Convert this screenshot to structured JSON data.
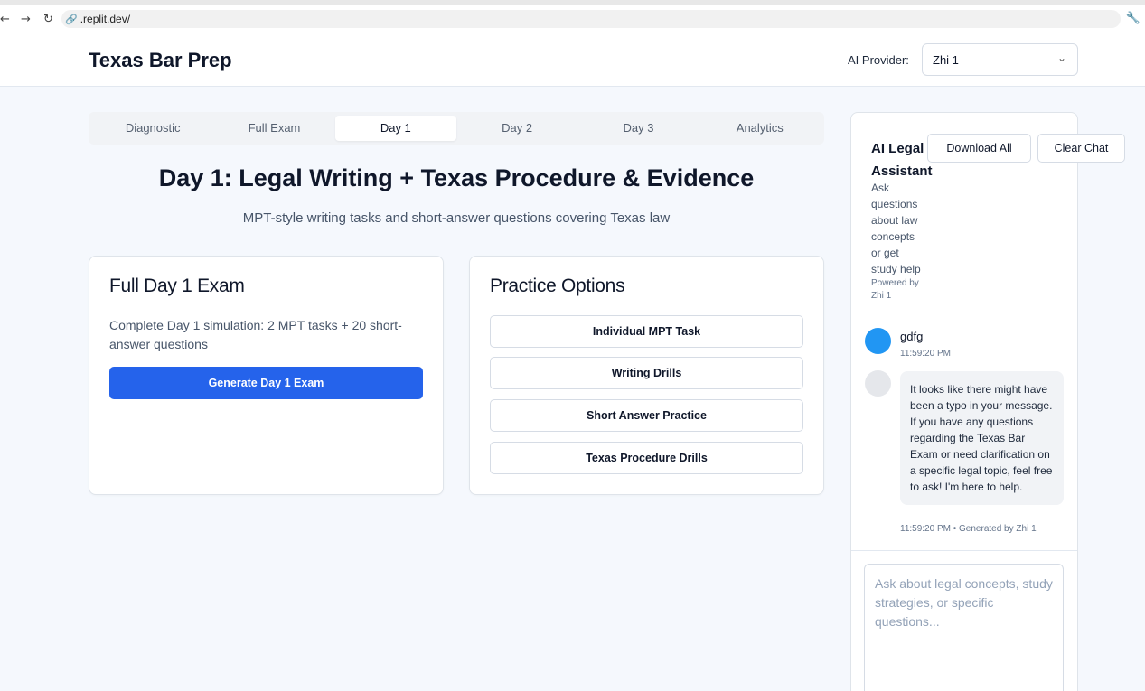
{
  "browser": {
    "back_glyph": "←",
    "forward_glyph": "→",
    "reload_glyph": "↻",
    "link_glyph": "🔗",
    "url": ".replit.dev/",
    "wrench_glyph": "🔧"
  },
  "header": {
    "title": "Texas Bar Prep",
    "provider_label": "AI Provider:",
    "provider_value": "Zhi 1",
    "chevron_glyph": "⌄"
  },
  "tabs": [
    {
      "label": "Diagnostic",
      "active": false
    },
    {
      "label": "Full Exam",
      "active": false
    },
    {
      "label": "Day 1",
      "active": true
    },
    {
      "label": "Day 2",
      "active": false
    },
    {
      "label": "Day 3",
      "active": false
    },
    {
      "label": "Analytics",
      "active": false
    }
  ],
  "main": {
    "heading": "Day 1: Legal Writing + Texas Procedure & Evidence",
    "subheading": "MPT-style writing tasks and short-answer questions covering Texas law",
    "full_exam_card": {
      "title": "Full Day 1 Exam",
      "description": "Complete Day 1 simulation: 2 MPT tasks + 20 short-answer questions",
      "button": "Generate Day 1 Exam"
    },
    "practice_card": {
      "title": "Practice Options",
      "options": [
        "Individual MPT Task",
        "Writing Drills",
        "Short Answer Practice",
        "Texas Procedure Drills"
      ]
    }
  },
  "chat": {
    "title": "AI Legal Assistant",
    "description": "Ask questions about law concepts or get study help",
    "powered_by": "Powered by Zhi 1",
    "download_button": "Download All",
    "clear_button": "Clear Chat",
    "messages": [
      {
        "role": "user",
        "text": "gdfg",
        "meta": "11:59:20 PM"
      },
      {
        "role": "assistant",
        "text": "It looks like there might have been a typo in your message. If you have any questions regarding the Texas Bar Exam or need clarification on a specific legal topic, feel free to ask! I'm here to help.",
        "meta": "11:59:20 PM • Generated by Zhi 1"
      }
    ],
    "input_placeholder": "Ask about legal concepts, study strategies, or specific questions...",
    "input_value": ""
  },
  "colors": {
    "primary": "#2563eb",
    "user_avatar": "#2196f3",
    "assistant_avatar": "#e5e7eb",
    "page_background": "#f5f8fd"
  }
}
